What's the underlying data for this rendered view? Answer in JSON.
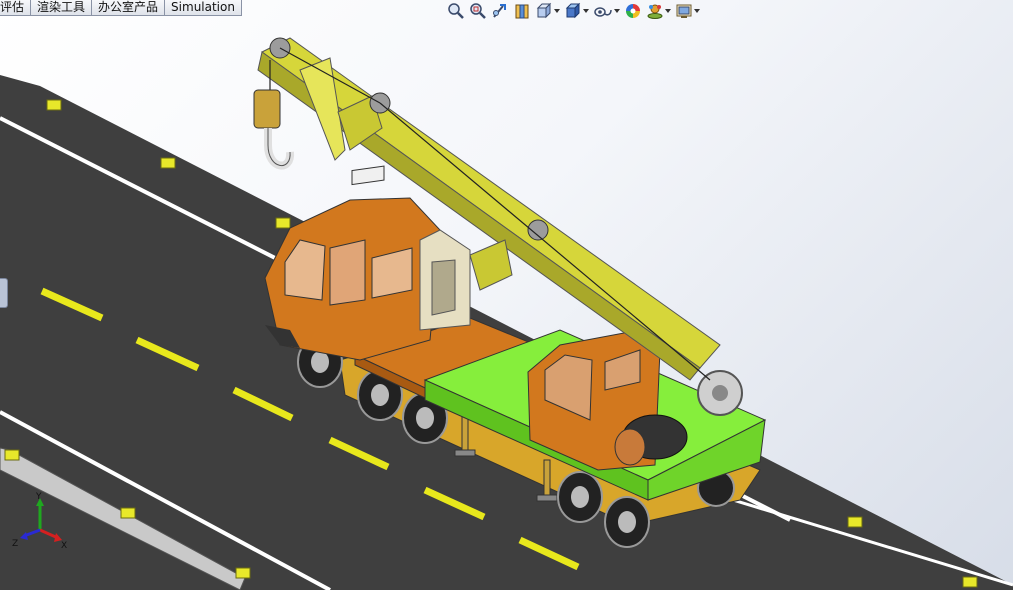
{
  "command_tabs": [
    {
      "label": "评估"
    },
    {
      "label": "渲染工具"
    },
    {
      "label": "办公室产品"
    },
    {
      "label": "Simulation"
    }
  ],
  "heads_up_toolbar": [
    {
      "icon": "zoom-to-fit-icon"
    },
    {
      "icon": "zoom-to-area-icon"
    },
    {
      "icon": "previous-view-icon"
    },
    {
      "icon": "section-view-icon"
    },
    {
      "icon": "view-orientation-icon",
      "dropdown": true
    },
    {
      "icon": "display-style-icon",
      "dropdown": true
    },
    {
      "icon": "hide-show-items-icon",
      "dropdown": true
    },
    {
      "icon": "edit-appearance-icon"
    },
    {
      "icon": "apply-scene-icon",
      "dropdown": true
    },
    {
      "icon": "view-settings-icon",
      "dropdown": true
    }
  ],
  "axis_triad": {
    "x": "X",
    "y": "Y",
    "z": "Z"
  },
  "colors": {
    "road": "#3f3f3f",
    "lane_stripe": "#e8e81c",
    "edge_line": "#ffffff",
    "boom": "#d6d63a",
    "cab": "#d2781e",
    "deck_green": "#86ee3c",
    "x_axis": "#d42020",
    "y_axis": "#1fa81f",
    "z_axis": "#2a2ad4"
  }
}
